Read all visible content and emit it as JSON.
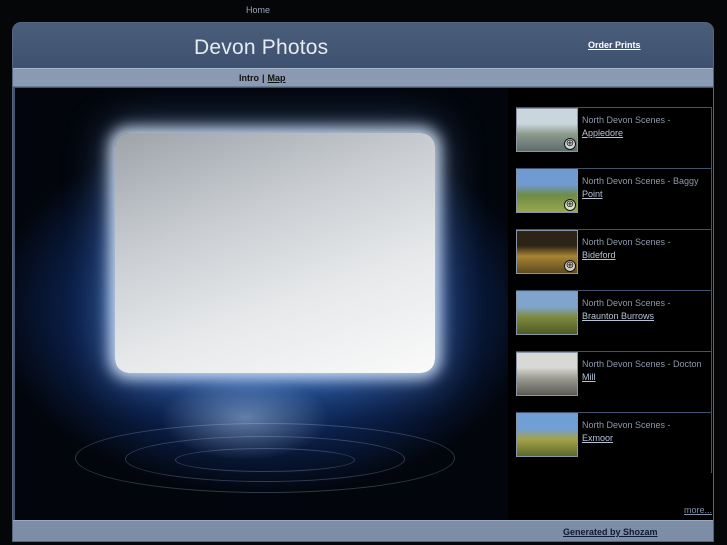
{
  "top_nav": {
    "home": "Home"
  },
  "header": {
    "title": "Devon Photos",
    "order_prints": "Order Prints"
  },
  "subnav": {
    "intro": "Intro",
    "separator": "|",
    "map": "Map"
  },
  "gallery": [
    {
      "prefix": "North Devon Scenes -",
      "link": "Appledore",
      "colors": [
        "#c9d6de",
        "#8c9a8a",
        "#5d6c6e"
      ],
      "zoom": true
    },
    {
      "prefix": "North Devon Scenes - Baggy",
      "link": "Point",
      "colors": [
        "#6f9bd0",
        "#6d8c45",
        "#9aa64d"
      ],
      "zoom": true
    },
    {
      "prefix": "North Devon Scenes -",
      "link": "Bideford",
      "colors": [
        "#2c2416",
        "#a88434",
        "#5d4b20"
      ],
      "zoom": true
    },
    {
      "prefix": "North Devon Scenes -",
      "link": "Braunton Burrows",
      "colors": [
        "#7fa5cc",
        "#7e8a3c",
        "#4e5a26"
      ],
      "zoom": false
    },
    {
      "prefix": "North Devon Scenes - Docton",
      "link": "Mill",
      "colors": [
        "#d8d8d4",
        "#9c9c94",
        "#5a5a54"
      ],
      "zoom": false
    },
    {
      "prefix": "North Devon Scenes -",
      "link": "Exmoor",
      "colors": [
        "#6f9fd4",
        "#a6a14a",
        "#5a6a2a"
      ],
      "zoom": false
    }
  ],
  "more": "more...",
  "footer": {
    "generated": "Generated by Shozam"
  },
  "colors": {
    "frame": "#41536f",
    "subbar": "#8a9ab2",
    "footer": "#7d8da6",
    "background": "#050608"
  }
}
